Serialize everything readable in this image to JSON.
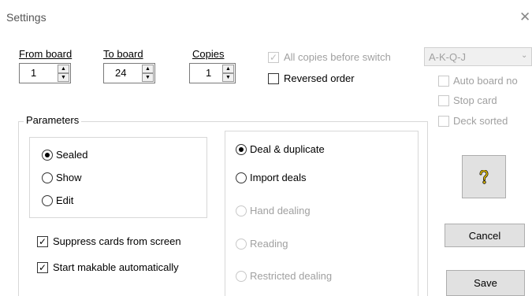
{
  "window": {
    "title": "Settings",
    "close_symbol": "✕"
  },
  "range": {
    "from_board": {
      "label": "From board",
      "value": "1"
    },
    "to_board": {
      "label": "To board",
      "value": "24"
    },
    "copies": {
      "label": "Copies",
      "value": "1"
    }
  },
  "options": {
    "all_copies_before_switch": {
      "label": "All copies before switch",
      "checked": true,
      "enabled": false
    },
    "reversed_order": {
      "label": "Reversed order",
      "checked": false,
      "enabled": true
    }
  },
  "deck": {
    "order_select": {
      "value": "A-K-Q-J",
      "enabled": false
    },
    "auto_board_no": {
      "label": "Auto board no",
      "checked": false,
      "enabled": false
    },
    "stop_card": {
      "label": "Stop card",
      "checked": false,
      "enabled": false
    },
    "deck_sorted": {
      "label": "Deck sorted",
      "checked": false,
      "enabled": false
    }
  },
  "parameters": {
    "legend": "Parameters",
    "view_mode": {
      "selected": "Sealed",
      "options": [
        "Sealed",
        "Show",
        "Edit"
      ]
    },
    "suppress_cards": {
      "label": "Suppress cards from screen",
      "checked": true
    },
    "start_makable": {
      "label": "Start makable automatically",
      "checked": true
    },
    "deal_mode": {
      "selected": "Deal & duplicate",
      "options": [
        {
          "label": "Deal & duplicate",
          "enabled": true
        },
        {
          "label": "Import deals",
          "enabled": true
        },
        {
          "label": "Hand dealing",
          "enabled": false
        },
        {
          "label": "Reading",
          "enabled": false
        },
        {
          "label": "Restricted dealing",
          "enabled": false
        }
      ]
    }
  },
  "buttons": {
    "help_icon": "help-icon",
    "cancel": "Cancel",
    "save": "Save"
  },
  "colors": {
    "disabled_text": "#a0a0a0",
    "help_icon": "#e8c200"
  }
}
